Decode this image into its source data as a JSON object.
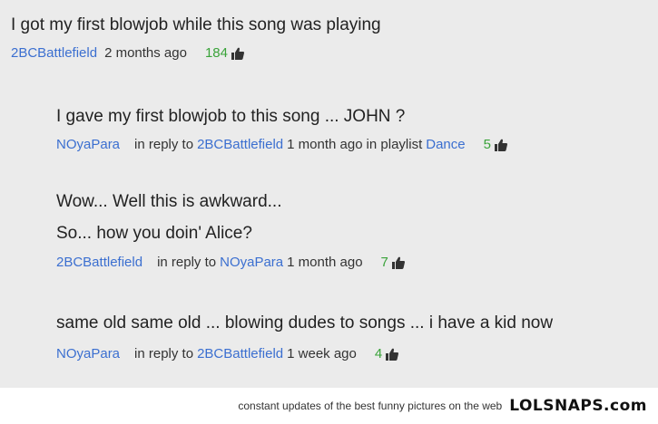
{
  "comments": [
    {
      "text": "I got my first blowjob while this song was playing",
      "user": "2BCBattlefield",
      "time": "2 months ago",
      "likes": "184"
    },
    {
      "text": "I gave my first blowjob to this song ... JOHN ?",
      "user": "NOyaPara",
      "reply_prefix": "in reply to",
      "reply_to": "2BCBattlefield",
      "time": "1 month ago",
      "playlist_prefix": "in playlist",
      "playlist": "Dance",
      "likes": "5"
    },
    {
      "text_line1": "Wow... Well this is awkward...",
      "text_line2": "So... how you doin' Alice?",
      "user": "2BCBattlefield",
      "reply_prefix": "in reply to",
      "reply_to": "NOyaPara",
      "time": "1 month ago",
      "likes": "7"
    },
    {
      "text": "same old same old ... blowing dudes to songs ... i have a kid now",
      "user": "NOyaPara",
      "reply_prefix": "in reply to",
      "reply_to": "2BCBattlefield",
      "time": "1 week ago",
      "likes": "4"
    }
  ],
  "footer": {
    "tagline": "constant updates of the best funny pictures on the web",
    "logo": "LOLSNAPS.com"
  },
  "colors": {
    "username": "#3b6fd0",
    "likes": "#3aa33a",
    "background": "#ebebeb"
  },
  "icons": {
    "like": "thumbs-up-icon"
  }
}
